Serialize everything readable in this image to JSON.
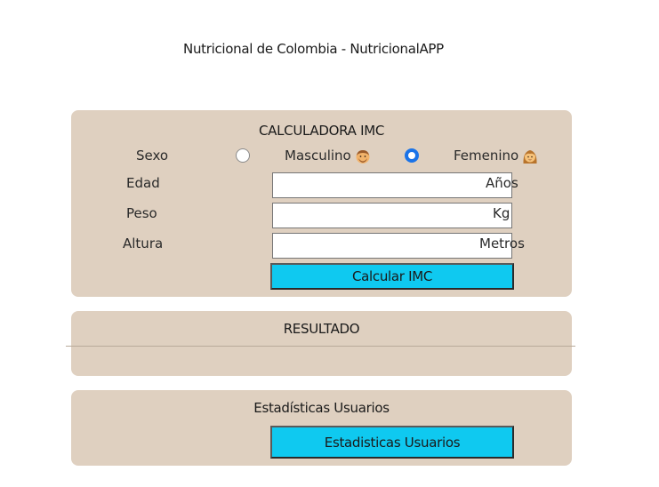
{
  "header": {
    "title": "Nutricional de Colombia - NutricionalAPP"
  },
  "imc": {
    "title": "CALCULADORA IMC",
    "sexo_label": "Sexo",
    "male_label": "Masculino",
    "female_label": "Femenino",
    "selected": "Femenino",
    "fields": [
      {
        "label": "Edad",
        "value": "",
        "unit": "Años"
      },
      {
        "label": "Peso",
        "value": "",
        "unit": "Kg"
      },
      {
        "label": "Altura",
        "value": "",
        "unit": "Metros"
      }
    ],
    "calc_button": "Calcular IMC"
  },
  "result": {
    "title": "RESULTADO",
    "value": ""
  },
  "stats": {
    "title": "Estadísticas Usuarios",
    "button": "Estadisticas Usuarios"
  },
  "colors": {
    "card_bg": "#dfd0c0",
    "button_bg": "#0fc9f0",
    "radio_accent": "#1a73e8"
  }
}
